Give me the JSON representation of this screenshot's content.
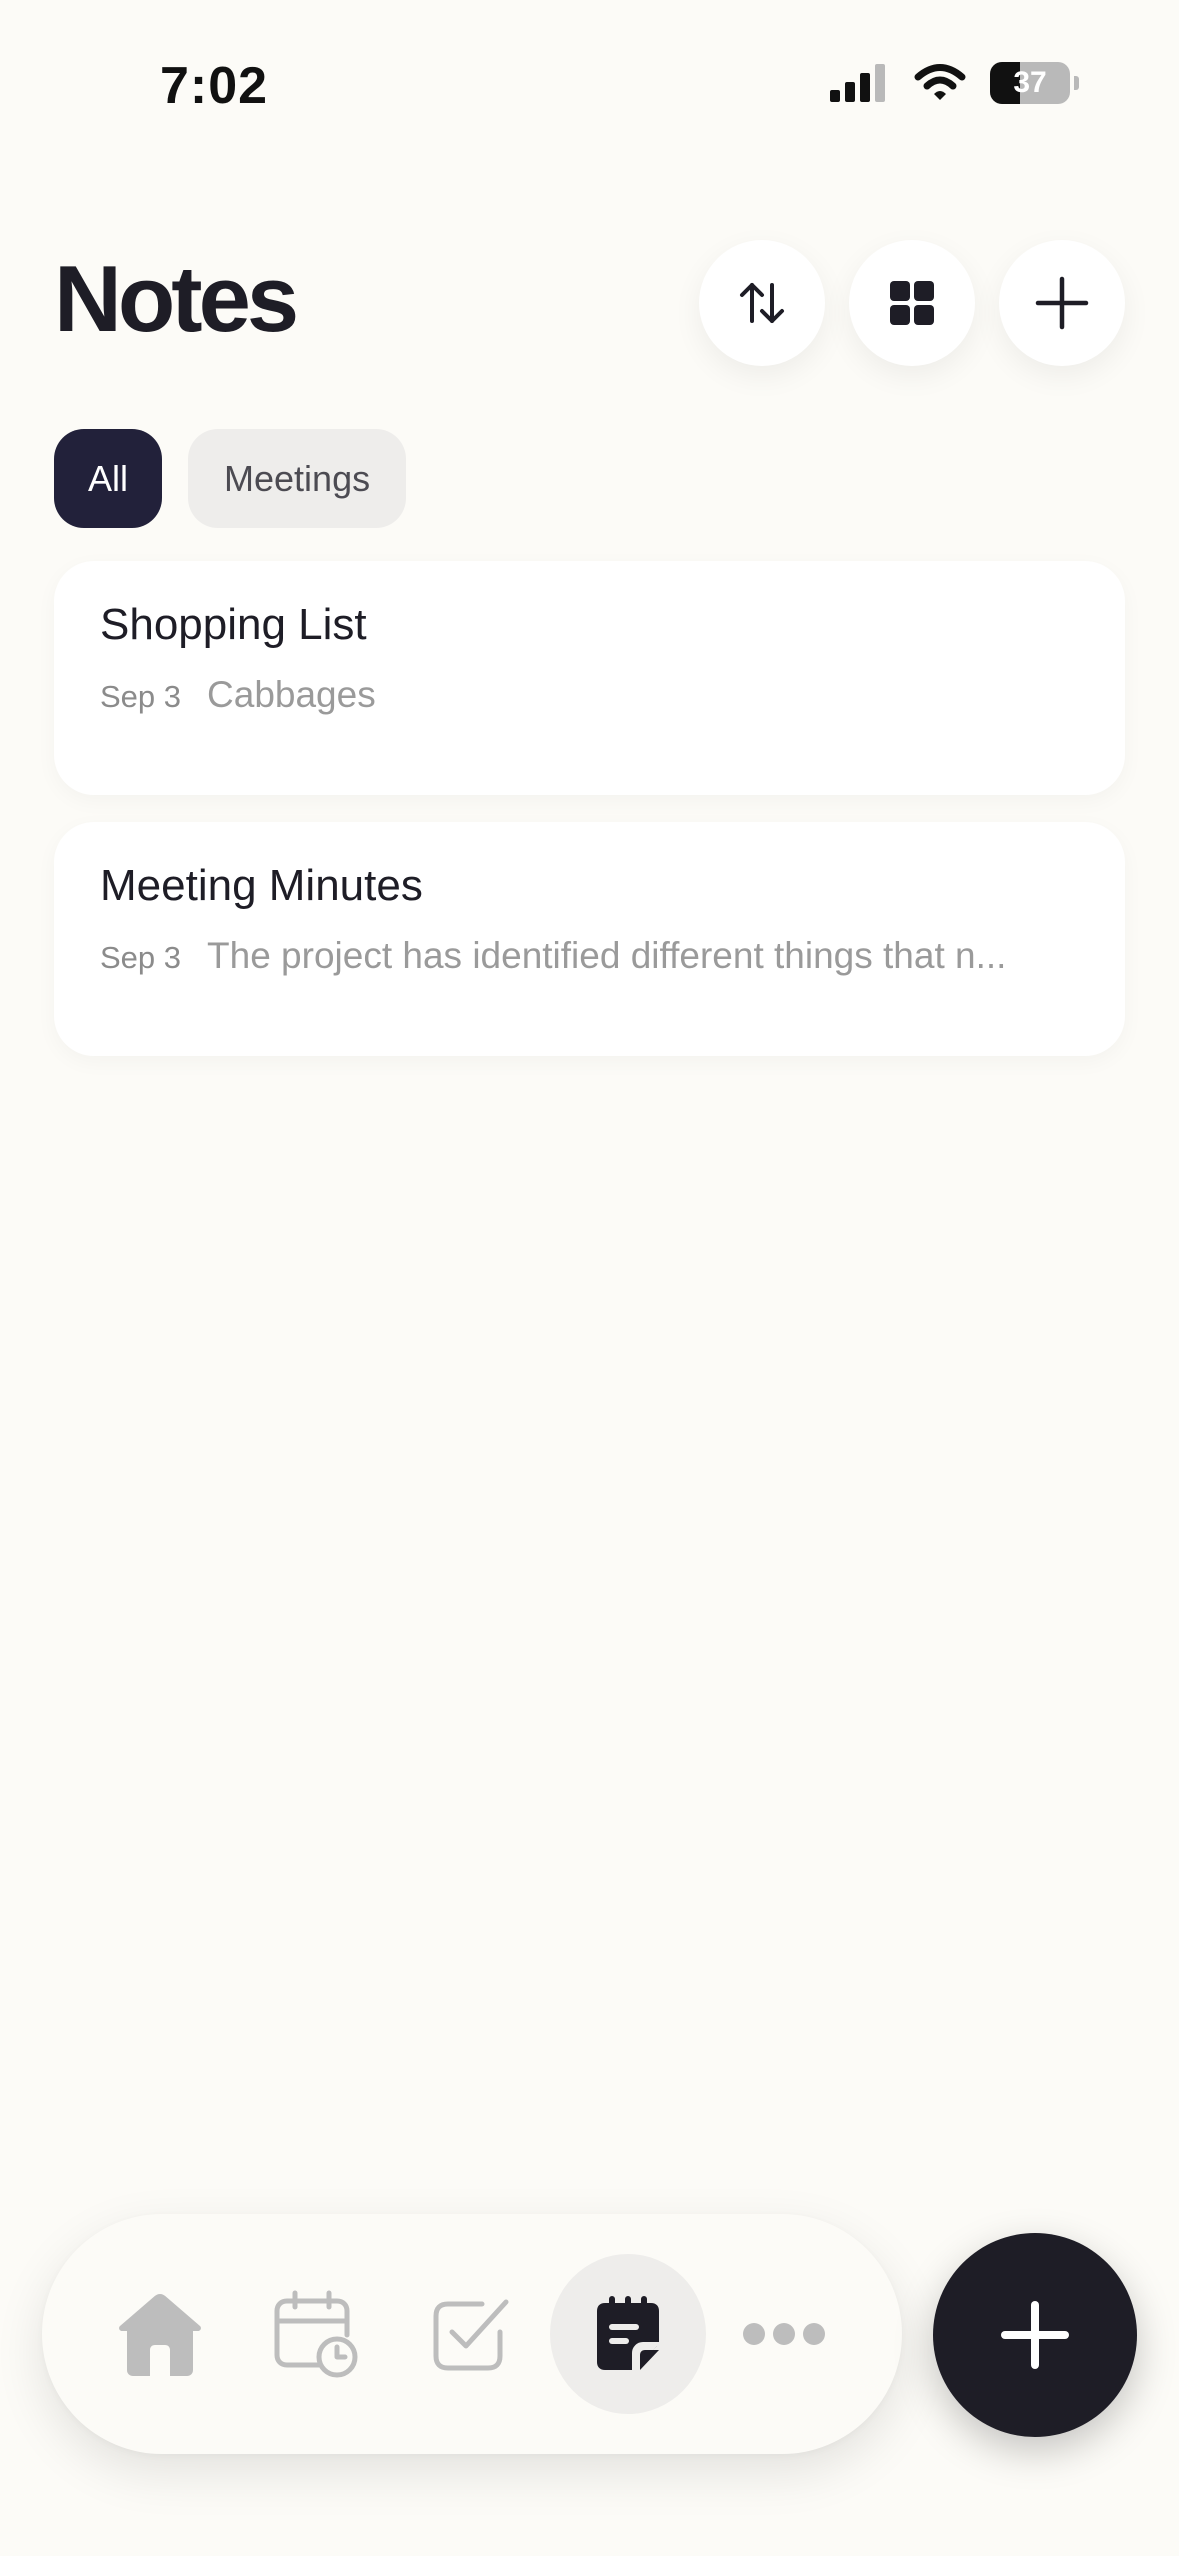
{
  "status_bar": {
    "time": "7:02",
    "battery_level": "37",
    "icons": [
      "signal-icon",
      "wifi-icon",
      "battery-icon"
    ]
  },
  "header": {
    "title": "Notes",
    "actions": [
      "sort-icon",
      "grid-view-icon",
      "add-icon"
    ]
  },
  "filters": [
    {
      "label": "All",
      "selected": true
    },
    {
      "label": "Meetings",
      "selected": false
    }
  ],
  "notes": [
    {
      "title": "Shopping List",
      "date": "Sep 3",
      "snippet": "Cabbages"
    },
    {
      "title": "Meeting Minutes",
      "date": "Sep 3",
      "snippet": "The project has identified different things that n..."
    }
  ],
  "bottom_nav": {
    "items": [
      "home-icon",
      "calendar-clock-icon",
      "task-check-icon",
      "notes-icon",
      "more-icon"
    ],
    "active": "notes-icon"
  },
  "fab_icon": "plus-icon",
  "colors": {
    "background": "#fcfbf7",
    "primary_dark": "#1e1d26",
    "chip_active": "#22213a",
    "chip_inactive": "#eeedeb",
    "nav_inactive_icon": "#bdbdbd"
  }
}
